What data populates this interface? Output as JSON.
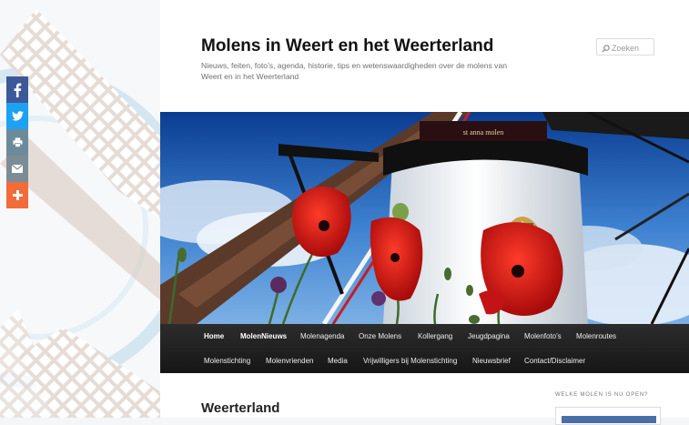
{
  "site": {
    "title": "Molens in Weert en het Weerterland",
    "description": "Nieuws, feiten, foto's, agenda, historie, tips en wetenswaardigheden over de molens van Weert en in het Weerterland"
  },
  "search": {
    "placeholder": "Zoeken",
    "icon": "search-icon"
  },
  "header_image": {
    "sign_text": "st anna   molen"
  },
  "nav": {
    "row1": [
      {
        "label": "Home",
        "active": true
      },
      {
        "label": "MolenNieuws",
        "active": true
      },
      {
        "label": "Molenagenda",
        "active": false
      },
      {
        "label": "Onze Molens",
        "active": false
      },
      {
        "label": "Kollergang",
        "active": false
      },
      {
        "label": "Jeugdpagina",
        "active": false
      },
      {
        "label": "Molenfoto's",
        "active": false
      },
      {
        "label": "Molenroutes",
        "active": false
      }
    ],
    "row2": [
      {
        "label": "Molenstichting",
        "active": false
      },
      {
        "label": "Molenvrienden",
        "active": false
      },
      {
        "label": "Media",
        "active": false
      },
      {
        "label": "Vrijwilligers bij Molenstichting",
        "active": false
      },
      {
        "label": "Nieuwsbrief",
        "active": false
      },
      {
        "label": "Contact/Disclaimer",
        "active": false
      }
    ]
  },
  "content": {
    "page_title": "Weerterland"
  },
  "sidebar": {
    "widget_title": "WELKE MOLEN IS NU OPEN?"
  },
  "share": {
    "buttons": [
      {
        "name": "facebook",
        "icon": "facebook-icon",
        "color": "#3b5998"
      },
      {
        "name": "twitter",
        "icon": "twitter-icon",
        "color": "#1da1f2"
      },
      {
        "name": "print",
        "icon": "print-icon",
        "color": "#6d8a9a"
      },
      {
        "name": "email",
        "icon": "email-icon",
        "color": "#7b8c95"
      },
      {
        "name": "more",
        "icon": "plus-icon",
        "color": "#f26b3a"
      }
    ]
  }
}
